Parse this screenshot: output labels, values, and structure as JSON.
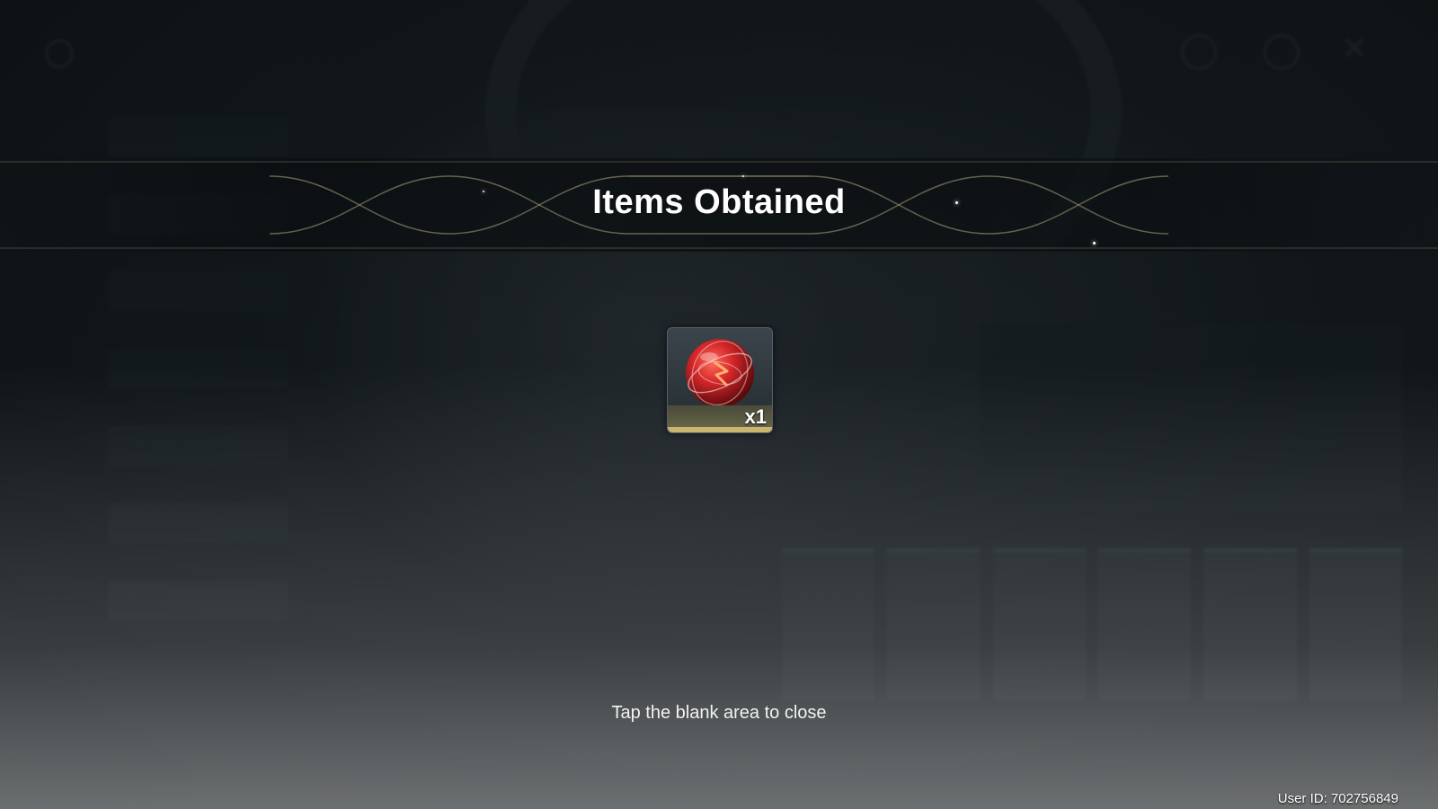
{
  "dialog": {
    "title": "Items Obtained",
    "item": {
      "icon": "red-orb-icon",
      "quantity": "x1"
    },
    "hint": "Tap the blank area to close"
  },
  "footer": {
    "user_id": "User ID: 702756849"
  },
  "colors": {
    "accent_gold": "#c9b56e",
    "orb_red": "#d4262a",
    "title_text": "#ffffff"
  }
}
